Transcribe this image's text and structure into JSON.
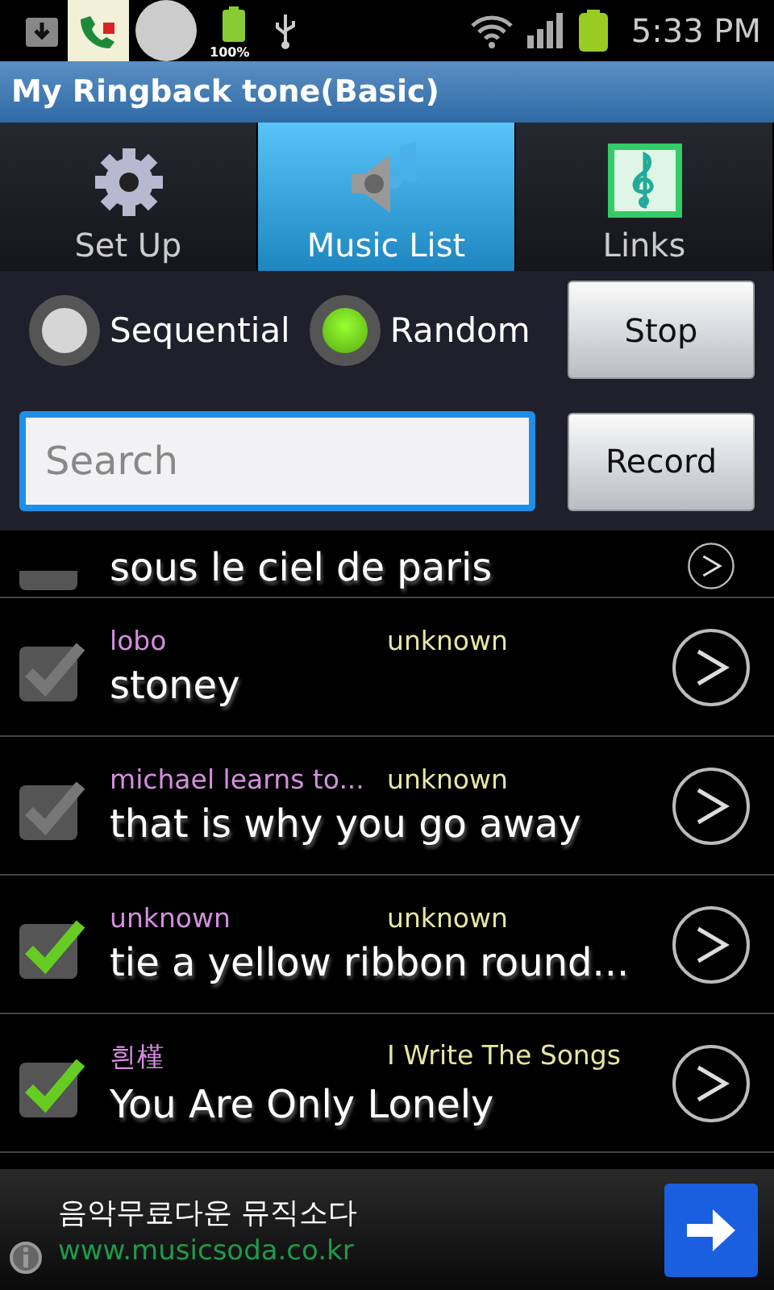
{
  "status_bar": {
    "battery_percent": "100%",
    "time": "5:33 PM"
  },
  "window": {
    "title": "My Ringback tone(Basic)"
  },
  "tabs": [
    {
      "label": "Set Up",
      "selected": false
    },
    {
      "label": "Music List",
      "selected": true
    },
    {
      "label": "Links",
      "selected": false
    }
  ],
  "play_mode": [
    {
      "label": "Sequential",
      "selected": false
    },
    {
      "label": "Random",
      "selected": true
    }
  ],
  "stop_button": "Stop",
  "search": {
    "placeholder": "Search"
  },
  "record_button": "Record",
  "songs": [
    {
      "title": "sous le ciel de paris",
      "checked": false
    },
    {
      "artist": "lobo",
      "album": "unknown",
      "title": "stoney",
      "checked": false
    },
    {
      "artist": "michael learns to...",
      "album": "unknown",
      "title": "that is why you go away",
      "checked": false
    },
    {
      "artist": "unknown",
      "album": "unknown",
      "title": "tie a yellow ribbon round...",
      "checked": true
    },
    {
      "artist": "흰槿",
      "album": "I Write The Songs",
      "title": "You Are Only Lonely",
      "checked": true
    }
  ],
  "ad": {
    "headline": "음악무료다운 뮤직소다",
    "url": "www.musicsoda.co.kr"
  }
}
